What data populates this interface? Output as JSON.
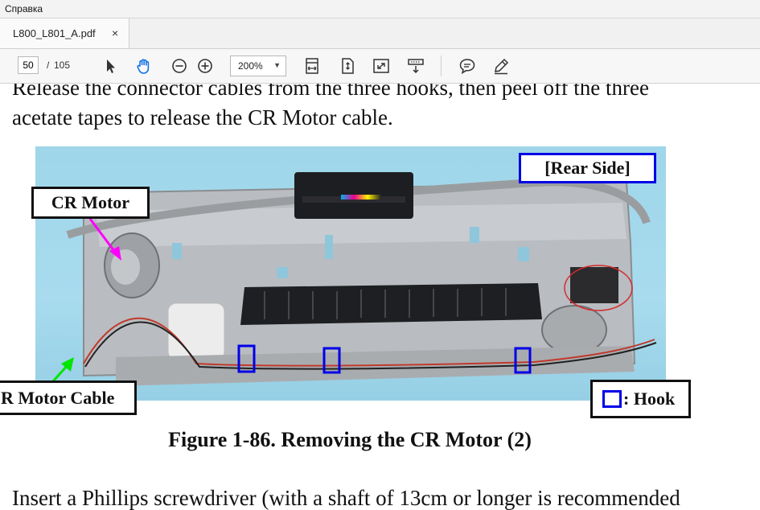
{
  "menubar": {
    "help_label": "Справка"
  },
  "tab": {
    "filename": "L800_L801_A.pdf",
    "close_glyph": "×"
  },
  "toolbar": {
    "page_current": "50",
    "page_separator": "/",
    "page_total": "105",
    "zoom_value": "200%",
    "icons": [
      "select-arrow-icon",
      "hand-tool-icon",
      "zoom-out-icon",
      "zoom-in-icon",
      "fit-width-icon",
      "fit-page-icon",
      "full-screen-icon",
      "scroll-mode-icon",
      "comment-icon",
      "highlight-pen-icon"
    ],
    "accent_color": "#1473e6"
  },
  "document": {
    "para1_line1": "Release the connector cables from the three hooks, then peel off the three",
    "para1_line2": "acetate tapes to release the CR Motor cable.",
    "figure": {
      "label_cr_motor": "CR Motor",
      "label_rear_side": "[Rear Side]",
      "label_cr_motor_cable": "R Motor Cable",
      "label_hook": ": Hook",
      "hook_box_color": "#0000e6",
      "arrow_magenta": "#ff00ff",
      "arrow_green": "#00e600"
    },
    "caption": "Figure 1-86.  Removing the CR Motor (2)",
    "para2_line1": "Insert a Phillips screwdriver (with a shaft of 13cm or longer is recommended"
  }
}
